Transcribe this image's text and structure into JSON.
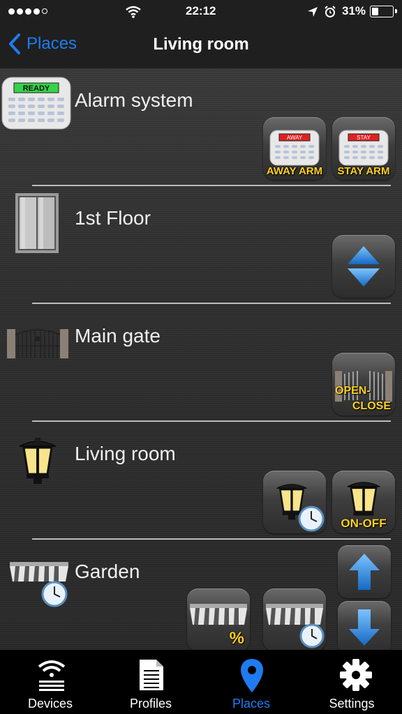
{
  "status_bar": {
    "time": "22:12",
    "battery": "31%"
  },
  "nav": {
    "back_label": "Places",
    "title": "Living room"
  },
  "rows": [
    {
      "title": "Alarm system",
      "buttons": [
        {
          "label": "AWAY ARM",
          "screen_text": "AWAY"
        },
        {
          "label": "STAY ARM",
          "screen_text": "STAY"
        }
      ],
      "icon_screen_text": "READY"
    },
    {
      "title": "1st Floor",
      "buttons": [
        {
          "label": ""
        }
      ]
    },
    {
      "title": "Main gate",
      "buttons": [
        {
          "label": "OPEN-",
          "label2": "CLOSE"
        }
      ]
    },
    {
      "title": "Living room",
      "buttons": [
        {
          "label": ""
        },
        {
          "label": "ON-OFF"
        }
      ]
    },
    {
      "title": "Garden",
      "buttons": [
        {
          "label": "%"
        },
        {
          "label": ""
        },
        {
          "label": ""
        },
        {
          "label": ""
        }
      ]
    }
  ],
  "tabs": [
    {
      "label": "Devices"
    },
    {
      "label": "Profiles"
    },
    {
      "label": "Places",
      "active": true
    },
    {
      "label": "Settings"
    }
  ],
  "colors": {
    "accent": "#1e7cf0",
    "button_label": "#ffd21f"
  }
}
